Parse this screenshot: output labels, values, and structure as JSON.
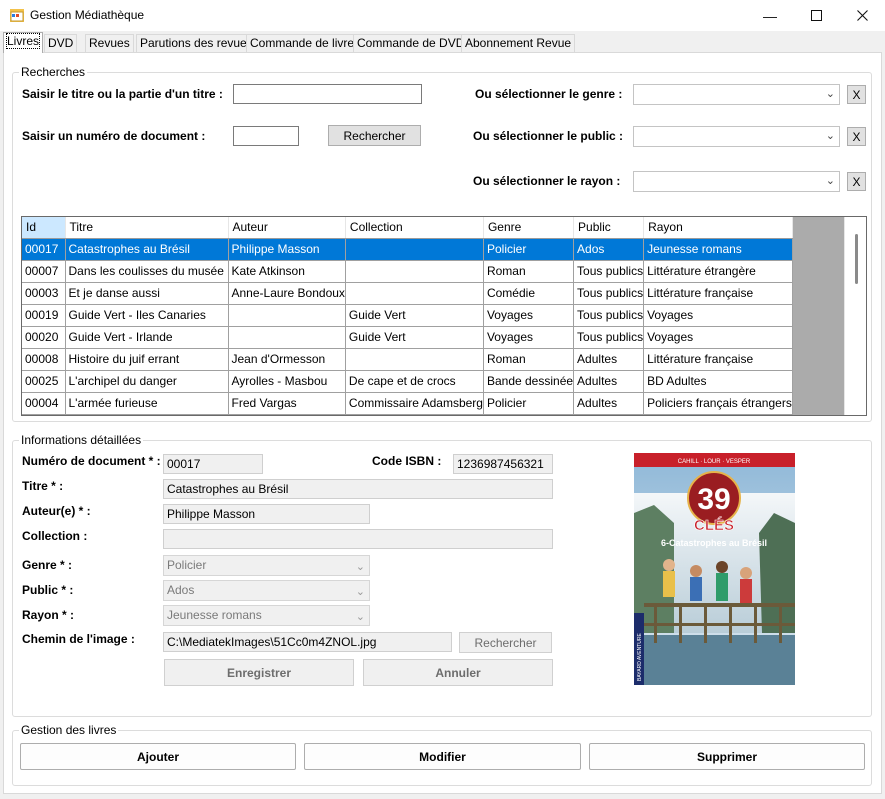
{
  "window": {
    "title": "Gestion Médiathèque"
  },
  "tabs": [
    "Livres",
    "DVD",
    "Revues",
    "Parutions des revues",
    "Commande de livres",
    "Commande de DVD",
    "Abonnement Revue"
  ],
  "search": {
    "legend": "Recherches",
    "title_label": "Saisir le titre ou la partie d'un titre :",
    "title_value": "",
    "docnum_label": "Saisir un numéro de document :",
    "docnum_value": "",
    "search_button": "Rechercher",
    "genre_label": "Ou sélectionner le genre :",
    "public_label": "Ou sélectionner le public :",
    "rayon_label": "Ou sélectionner le rayon :",
    "clear_label": "X"
  },
  "grid": {
    "columns": [
      "Id",
      "Titre",
      "Auteur",
      "Collection",
      "Genre",
      "Public",
      "Rayon"
    ],
    "rows": [
      [
        "00017",
        "Catastrophes au Brésil",
        "Philippe Masson",
        "",
        "Policier",
        "Ados",
        "Jeunesse romans"
      ],
      [
        "00007",
        "Dans les coulisses du musée",
        "Kate Atkinson",
        "",
        "Roman",
        "Tous publics",
        "Littérature étrangère"
      ],
      [
        "00003",
        "Et je danse aussi",
        "Anne-Laure Bondoux",
        "",
        "Comédie",
        "Tous publics",
        "Littérature française"
      ],
      [
        "00019",
        "Guide Vert - Iles Canaries",
        "",
        "Guide Vert",
        "Voyages",
        "Tous publics",
        "Voyages"
      ],
      [
        "00020",
        "Guide Vert - Irlande",
        "",
        "Guide Vert",
        "Voyages",
        "Tous publics",
        "Voyages"
      ],
      [
        "00008",
        "Histoire du juif errant",
        "Jean d'Ormesson",
        "",
        "Roman",
        "Adultes",
        "Littérature française"
      ],
      [
        "00025",
        "L'archipel du danger",
        "Ayrolles - Masbou",
        "De cape et de crocs",
        "Bande dessinée",
        "Adultes",
        "BD Adultes"
      ],
      [
        "00004",
        "L'armée furieuse",
        "Fred Vargas",
        "Commissaire Adamsberg",
        "Policier",
        "Adultes",
        "Policiers français étrangers"
      ]
    ],
    "selected_row": 0
  },
  "details": {
    "legend": "Informations détaillées",
    "docnum_label": "Numéro de document * :",
    "docnum_value": "00017",
    "isbn_label": "Code ISBN :",
    "isbn_value": "1236987456321",
    "titre_label": "Titre * :",
    "titre_value": "Catastrophes au Brésil",
    "auteur_label": "Auteur(e) * :",
    "auteur_value": "Philippe Masson",
    "collection_label": "Collection :",
    "collection_value": "",
    "genre_label": "Genre * :",
    "genre_value": "Policier",
    "public_label": "Public * :",
    "public_value": "Ados",
    "rayon_label": "Rayon * :",
    "rayon_value": "Jeunesse romans",
    "image_label": "Chemin de l'image :",
    "image_value": "C:\\MediatekImages\\51Cc0m4ZNOL.jpg",
    "browse_button": "Rechercher",
    "save_button": "Enregistrer",
    "cancel_button": "Annuler"
  },
  "cover": {
    "series_number": "39",
    "series_word": "CLÉS",
    "book_title": "6-Catastrophes au Brésil",
    "authors": "CAHILL · LOUR · VESPER",
    "publisher": "BAYARD AVENTURE"
  },
  "manage": {
    "legend": "Gestion des livres",
    "add_button": "Ajouter",
    "edit_button": "Modifier",
    "delete_button": "Supprimer"
  },
  "colors": {
    "selection": "#0078d7",
    "window_bg": "#f0f0f0"
  }
}
